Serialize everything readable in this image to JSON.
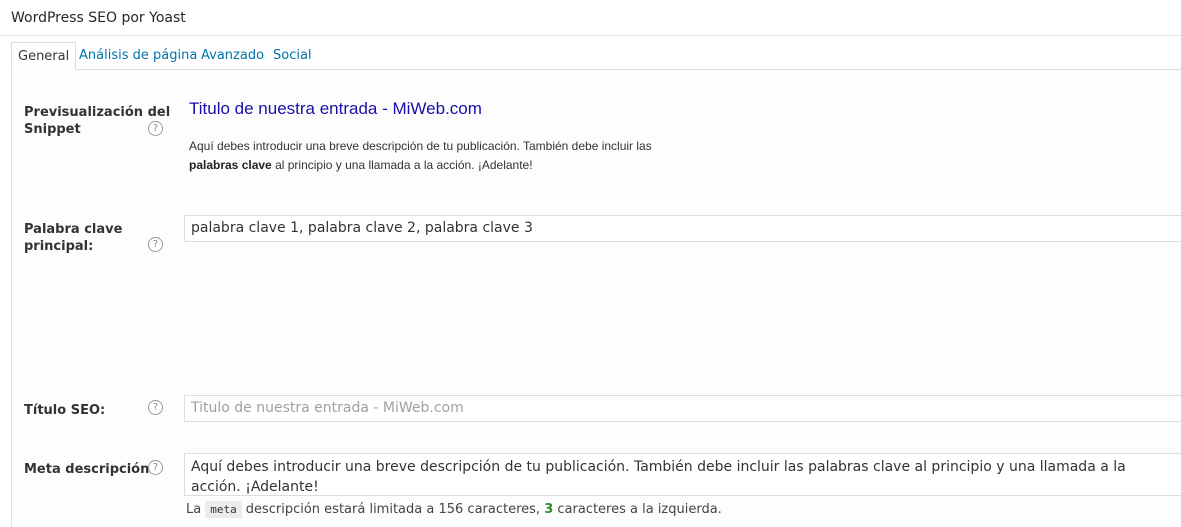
{
  "header": {
    "title": "WordPress SEO por Yoast"
  },
  "tabs": [
    {
      "label": "General",
      "active": true
    },
    {
      "label": "Análisis de página",
      "active": false
    },
    {
      "label": "Avanzado",
      "active": false
    },
    {
      "label": "Social",
      "active": false
    }
  ],
  "help_icon_glyph": "?",
  "snippet": {
    "label_line1": "Previsualización del",
    "label_line2": "Snippet",
    "title": "Titulo de nuestra entrada - MiWeb.com",
    "desc_part1": "Aquí debes introducir una breve descripción de tu publicación. También debe incluir las",
    "desc_bold": "palabras clave",
    "desc_part2": "al principio y una llamada a la acción. ¡Adelante!"
  },
  "focus_keyword": {
    "label_line1": "Palabra clave",
    "label_line2": "principal:",
    "value": "palabra clave 1, palabra clave 2, palabra clave 3"
  },
  "seo_title": {
    "label": "Título SEO:",
    "placeholder": "Titulo de nuestra entrada - MiWeb.com"
  },
  "meta_description": {
    "label": "Meta descripción:",
    "value": "Aquí debes introducir una breve descripción de tu publicación. También debe incluir las palabras clave al principio y una llamada a la acción. ¡Adelante!",
    "counter_prefix": "La",
    "counter_code": "meta",
    "counter_middle": "descripción estará limitada a 156 caracteres,",
    "counter_number": "3",
    "counter_suffix": "caracteres a la izquierda."
  },
  "colors": {
    "link": "#0073aa",
    "snippet_title": "#1a0dab",
    "counter_ok": "#2e8b2e"
  }
}
